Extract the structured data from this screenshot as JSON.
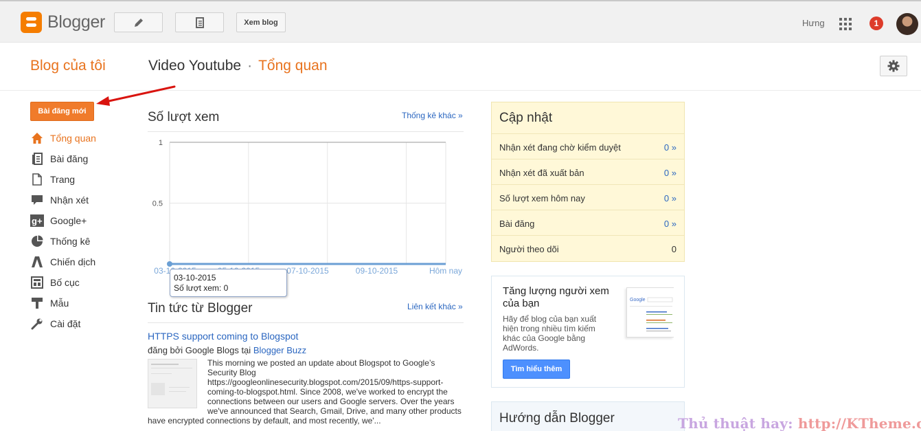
{
  "topbar": {
    "logo_text": "Blogger",
    "view_blog_label": "Xem blog",
    "user_name": "Hưng",
    "notification_count": "1"
  },
  "header": {
    "my_blogs": "Blog của tôi",
    "blog_name": "Video Youtube",
    "separator": "·",
    "current_page": "Tổng quan"
  },
  "sidebar": {
    "new_post_label": "Bài đăng mới",
    "items": [
      {
        "label": "Tổng quan",
        "icon": "home-icon",
        "active": true
      },
      {
        "label": "Bài đăng",
        "icon": "posts-icon",
        "active": false
      },
      {
        "label": "Trang",
        "icon": "page-icon",
        "active": false
      },
      {
        "label": "Nhận xét",
        "icon": "comment-icon",
        "active": false
      },
      {
        "label": "Google+",
        "icon": "google-plus-icon",
        "active": false
      },
      {
        "label": "Thống kê",
        "icon": "stats-icon",
        "active": false
      },
      {
        "label": "Chiến dịch",
        "icon": "campaign-icon",
        "active": false
      },
      {
        "label": "Bố cục",
        "icon": "layout-icon",
        "active": false
      },
      {
        "label": "Mẫu",
        "icon": "template-icon",
        "active": false
      },
      {
        "label": "Cài đặt",
        "icon": "wrench-icon",
        "active": false
      }
    ]
  },
  "views": {
    "title": "Số lượt xem",
    "more_stats": "Thống kê khác »",
    "tooltip_date": "03-10-2015",
    "tooltip_value": "Số lượt xem: 0"
  },
  "chart_data": {
    "type": "line",
    "categories": [
      "03-10-2015",
      "05-10-2015",
      "07-10-2015",
      "09-10-2015",
      "Hôm nay"
    ],
    "x_tick_labels": [
      "03-10-2015",
      "05-10-2015",
      "07-10-2015",
      "09-10-2015",
      "Hôm nay"
    ],
    "y_tick_labels": [
      "1",
      "0.5"
    ],
    "series": [
      {
        "values": [
          0,
          0,
          0,
          0,
          0
        ]
      }
    ],
    "ylim": [
      0,
      1
    ],
    "grid": true,
    "line_color": "#6b9fd4"
  },
  "news": {
    "title": "Tin tức từ Blogger",
    "more_links": "Liên kết khác »",
    "post_title": "HTTPS support coming to Blogspot",
    "byline_prefix": "đăng bởi Google Blogs tại",
    "byline_source": "Blogger Buzz",
    "body": "This morning we posted an update about Blogspot to Google’s Security Blog https://googleonlinesecurity.blogspot.com/2015/09/https-support-coming-to-blogspot.html. Since 2008, we've worked to encrypt the connections between our users and Google servers. Over the years we've announced that Search, Gmail, Drive, and many other products have encrypted connections by default, and most recently, we'..."
  },
  "updates": {
    "title": "Cập nhật",
    "rows": [
      {
        "label": "Nhận xét đang chờ kiểm duyệt",
        "value": "0 »"
      },
      {
        "label": "Nhận xét đã xuất bản",
        "value": "0 »"
      },
      {
        "label": "Số lượt xem hôm nay",
        "value": "0 »"
      },
      {
        "label": "Bài đăng",
        "value": "0 »"
      },
      {
        "label": "Người theo dõi",
        "value": "0"
      }
    ]
  },
  "promo": {
    "title": "Tăng lượng người xem của bạn",
    "body": "Hãy để blog của bạn xuất hiện trong nhiều tìm kiếm khác của Google bằng AdWords.",
    "button": "Tìm hiểu thêm",
    "thumb_brand": "Google"
  },
  "guide": {
    "title": "Hướng dẫn Blogger"
  },
  "watermark": {
    "prefix": "Thủ thuật hay:",
    "url": "http://KTheme.com"
  },
  "colors": {
    "accent_orange": "#e8731e",
    "link_blue": "#2a66c0",
    "updates_bg": "#fff8d8"
  }
}
